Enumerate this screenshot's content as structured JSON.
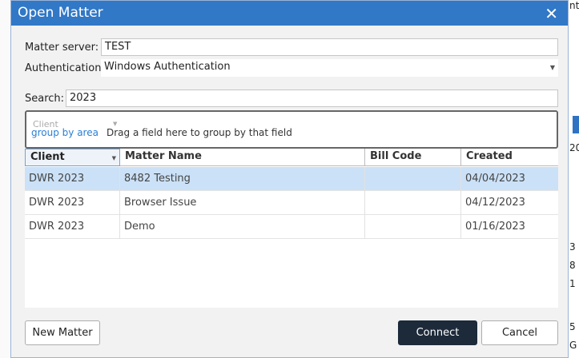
{
  "dialog": {
    "title": "Open Matter"
  },
  "form": {
    "server_label": "Matter server:",
    "server_value": "TEST",
    "auth_label": "Authentication:",
    "auth_value": "Windows Authentication",
    "search_label": "Search:",
    "search_value": "2023"
  },
  "grid": {
    "group_chip": "Client",
    "group_area_text": "group by area",
    "group_hint": "Drag a field here to group by that field",
    "columns": [
      "Client",
      "Matter Name",
      "Bill Code",
      "Created"
    ],
    "rows": [
      {
        "client": "DWR 2023",
        "matter": "8482 Testing",
        "bill": "",
        "created": "04/04/2023"
      },
      {
        "client": "DWR 2023",
        "matter": "Browser Issue",
        "bill": "",
        "created": "04/12/2023"
      },
      {
        "client": "DWR 2023",
        "matter": "Demo",
        "bill": "",
        "created": "01/16/2023"
      }
    ]
  },
  "buttons": {
    "new_matter": "New Matter",
    "connect": "Connect",
    "cancel": "Cancel"
  },
  "background": {
    "top_fragment": "nt",
    "side_fragments": [
      "20",
      "3",
      "8",
      "1",
      "5",
      "G"
    ]
  },
  "colors": {
    "titlebar": "#3178c6",
    "selected_row": "#cbe1f7",
    "primary_button": "#1c2a3a"
  }
}
